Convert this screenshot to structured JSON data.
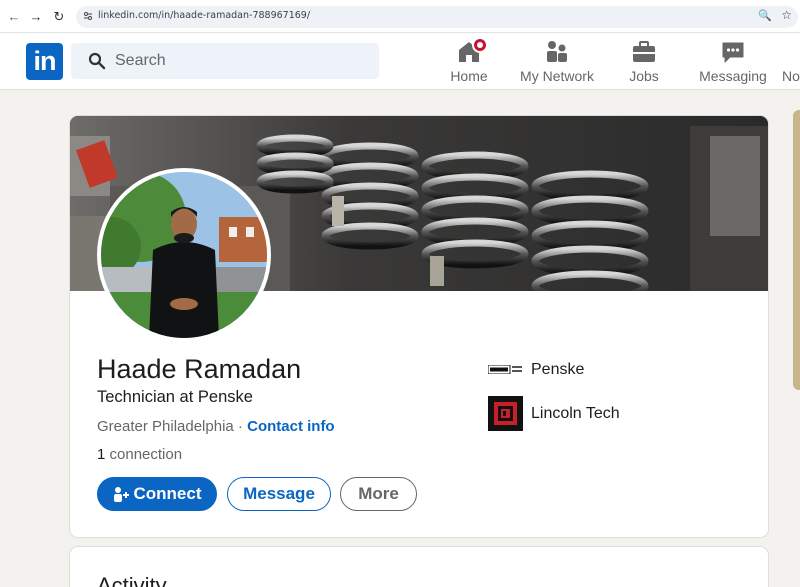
{
  "browser": {
    "url": "linkedin.com/in/haade-ramadan-788967169/",
    "icons": [
      "back-icon",
      "forward-icon",
      "reload-icon",
      "site-settings-icon",
      "zoom-icon",
      "bookmark-star-icon"
    ]
  },
  "header": {
    "logo_text": "in",
    "search_placeholder": "Search",
    "nav": [
      {
        "label": "Home",
        "icon": "home-icon",
        "has_notification": true
      },
      {
        "label": "My Network",
        "icon": "network-icon"
      },
      {
        "label": "Jobs",
        "icon": "briefcase-icon"
      },
      {
        "label": "Messaging",
        "icon": "messaging-icon"
      },
      {
        "label": "No",
        "icon": "bell-icon"
      }
    ]
  },
  "profile": {
    "name": "Haade Ramadan",
    "headline": "Technician at Penske",
    "location": "Greater Philadelphia",
    "separator": " · ",
    "contact_info": "Contact info",
    "connections_count": "1",
    "connections_label": " connection",
    "buttons": {
      "connect": "Connect",
      "message": "Message",
      "more": "More"
    },
    "companies": [
      {
        "name": "Penske",
        "logo": "penske-logo"
      },
      {
        "name": "Lincoln Tech",
        "logo": "lincoln-tech-logo"
      }
    ]
  },
  "activity": {
    "title": "Activity"
  },
  "colors": {
    "brand_blue": "#0a66c2",
    "page_bg": "#f4f2ee",
    "notification_red": "#cb112d"
  }
}
